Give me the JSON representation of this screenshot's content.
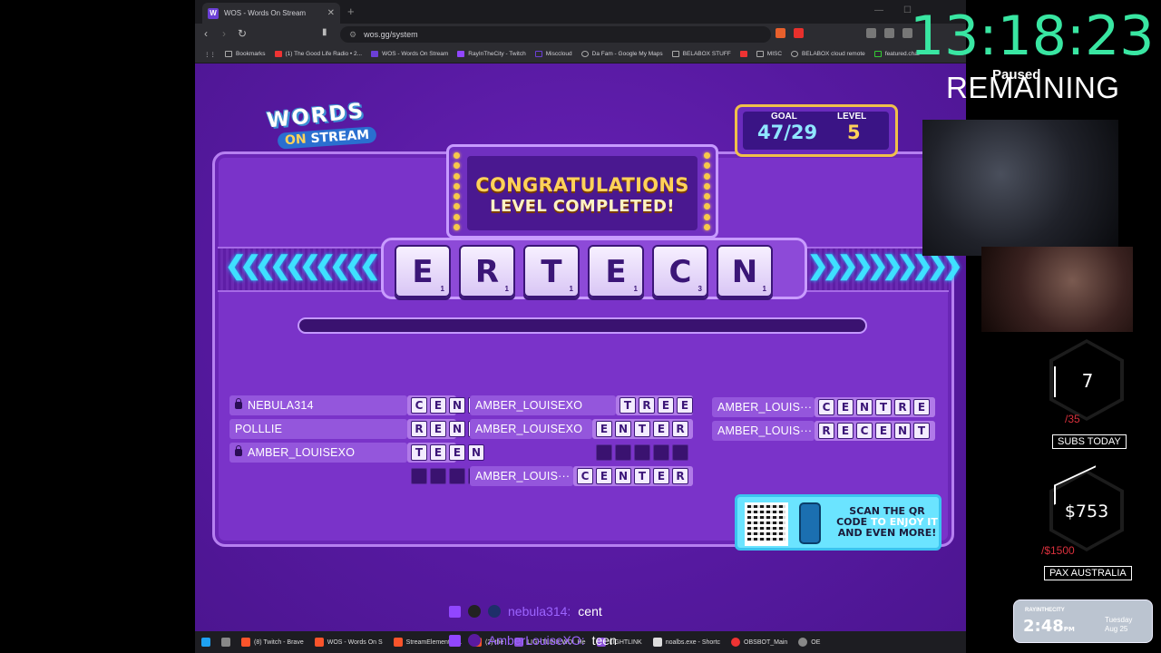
{
  "browser": {
    "tab_title": "WOS - Words On Stream",
    "url": "wos.gg/system",
    "bookmarks": [
      "Bookmarks",
      "(1) The Good Life Radio • 2...",
      "WOS - Words On Stream",
      "RayInTheCity - Twitch",
      "Misccloud",
      "Da Fam - Google My Maps",
      "BELABOX STUFF",
      "MISC",
      "BELABOX cloud remote",
      "featured.chat"
    ]
  },
  "game": {
    "logo_line1": "WORDS",
    "logo_line2_on": "ON",
    "logo_line2_stream": "STREAM",
    "congrats_line1": "CONGRATULATIONS",
    "congrats_line2": "LEVEL COMPLETED!",
    "goal_label": "GOAL",
    "goal_value": "47/29",
    "level_label": "LEVEL",
    "level_value": "5",
    "letters": [
      {
        "ch": "E",
        "score": "1"
      },
      {
        "ch": "R",
        "score": "1"
      },
      {
        "ch": "T",
        "score": "1"
      },
      {
        "ch": "E",
        "score": "1"
      },
      {
        "ch": "C",
        "score": "3"
      },
      {
        "ch": "N",
        "score": "1"
      }
    ],
    "words": [
      {
        "player": "NEBULA314",
        "letters": [
          "C",
          "E",
          "N",
          "T"
        ],
        "locked": true
      },
      {
        "player": "POLLLIE",
        "letters": [
          "R",
          "E",
          "N",
          "T"
        ],
        "locked": false
      },
      {
        "player": "AMBER_LOUISEXO",
        "letters": [
          "T",
          "E",
          "E",
          "N"
        ],
        "locked": true
      },
      {
        "player": "",
        "letters": [
          "",
          "",
          "",
          ""
        ],
        "locked": false
      },
      {
        "player": "AMBER_LOUISEXO",
        "letters": [
          "T",
          "R",
          "E",
          "E"
        ],
        "locked": false
      },
      {
        "player": "AMBER_LOUISEXO",
        "letters": [
          "E",
          "N",
          "T",
          "E",
          "R"
        ],
        "locked": false
      },
      {
        "player": "",
        "letters": [
          "",
          "",
          "",
          "",
          ""
        ],
        "locked": false
      },
      {
        "player": "AMBER_LOUIS···",
        "letters": [
          "C",
          "E",
          "N",
          "T",
          "E",
          "R"
        ],
        "locked": false
      },
      {
        "player": "AMBER_LOUIS···",
        "letters": [
          "C",
          "E",
          "N",
          "T",
          "R",
          "E"
        ],
        "locked": false
      },
      {
        "player": "AMBER_LOUIS···",
        "letters": [
          "R",
          "E",
          "C",
          "E",
          "N",
          "T"
        ],
        "locked": false
      }
    ],
    "qr_text_line1": "SCAN THE QR",
    "qr_text_line2a": "CODE",
    "qr_text_line2b": "TO ENJOY IT",
    "qr_text_line3": "AND EVEN MORE!"
  },
  "chat": [
    {
      "user": "nebula314:",
      "msg": "cent"
    },
    {
      "user": "AmberLouiseXO:",
      "msg": "teen"
    }
  ],
  "taskbar": [
    "(8) Twitch - Brave",
    "WOS - Words On S",
    "StreamElements | 1",
    "(2) the",
    "LIGHTLINK WDL He",
    "LIGHTLINK",
    "noalbs.exe - Shortc",
    "OBSBOT_Main",
    "OE"
  ],
  "overlay": {
    "timer": "13:18:23",
    "paused": "Paused",
    "remaining": "REMAINING",
    "subs_value": "7",
    "subs_goal": "/35",
    "subs_label": "SUBS TODAY",
    "money_value": "$753",
    "money_goal": "/$1500",
    "money_label": "PAX AUSTRALIA",
    "clock_brand": "RAYINTHECITY",
    "clock_time": "2:48",
    "clock_ampm": "PM",
    "clock_day": "Tuesday",
    "clock_date": "Aug 25"
  },
  "colors": {
    "timer": "#39e6a2",
    "game_bg": "#5a1aa0",
    "gold": "#ffd25a",
    "cyan": "#3fe0ff"
  }
}
